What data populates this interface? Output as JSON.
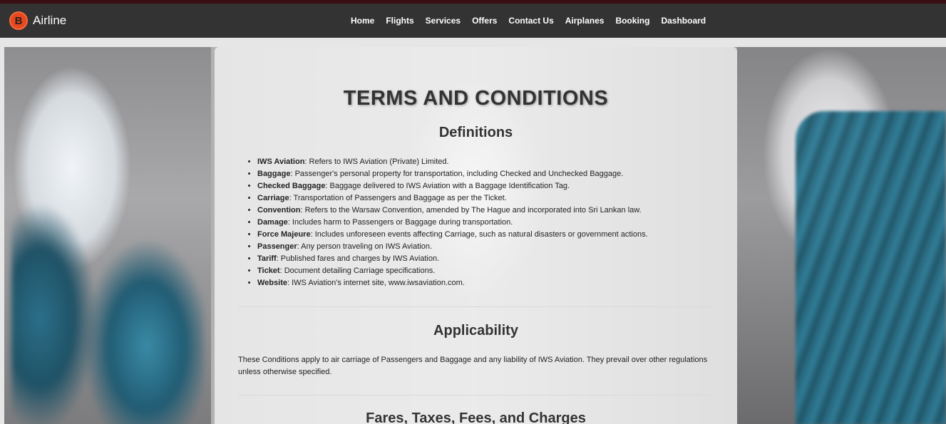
{
  "navbar": {
    "logo_letter": "B",
    "brand": "Airline",
    "links": [
      "Home",
      "Flights",
      "Services",
      "Offers",
      "Contact Us",
      "Airplanes",
      "Booking",
      "Dashboard"
    ]
  },
  "content": {
    "title": "TERMS AND CONDITIONS",
    "definitions": {
      "heading": "Definitions",
      "items": [
        {
          "term": "IWS Aviation",
          "text": ": Refers to IWS Aviation (Private) Limited."
        },
        {
          "term": "Baggage",
          "text": ": Passenger's personal property for transportation, including Checked and Unchecked Baggage."
        },
        {
          "term": "Checked Baggage",
          "text": ": Baggage delivered to IWS Aviation with a Baggage Identification Tag."
        },
        {
          "term": "Carriage",
          "text": ": Transportation of Passengers and Baggage as per the Ticket."
        },
        {
          "term": "Convention",
          "text": ": Refers to the Warsaw Convention, amended by The Hague and incorporated into Sri Lankan law."
        },
        {
          "term": "Damage",
          "text": ": Includes harm to Passengers or Baggage during transportation."
        },
        {
          "term": "Force Majeure",
          "text": ": Includes unforeseen events affecting Carriage, such as natural disasters or government actions."
        },
        {
          "term": "Passenger",
          "text": ": Any person traveling on IWS Aviation."
        },
        {
          "term": "Tariff",
          "text": ": Published fares and charges by IWS Aviation."
        },
        {
          "term": "Ticket",
          "text": ": Document detailing Carriage specifications."
        },
        {
          "term": "Website",
          "text": ": IWS Aviation's internet site, www.iwsaviation.com."
        }
      ]
    },
    "applicability": {
      "heading": "Applicability",
      "text": "These Conditions apply to air carriage of Passengers and Baggage and any liability of IWS Aviation. They prevail over other regulations unless otherwise specified."
    },
    "fares": {
      "heading": "Fares, Taxes, Fees, and Charges"
    }
  }
}
